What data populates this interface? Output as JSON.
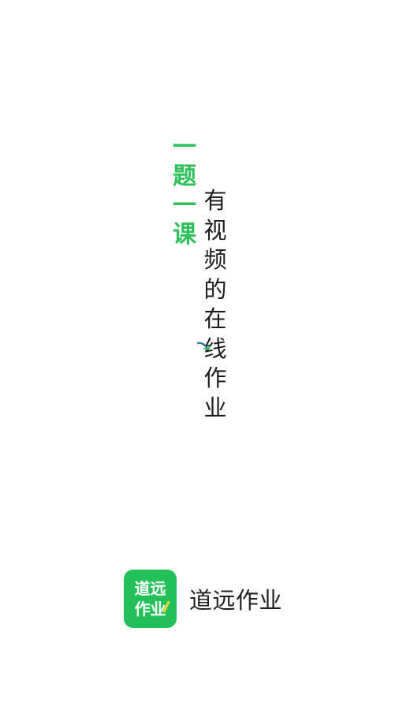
{
  "slogan": {
    "primary": [
      "一",
      "题",
      "一",
      "课"
    ],
    "secondary": [
      "有",
      "视",
      "频",
      "的",
      "在",
      "线",
      "作",
      "业"
    ]
  },
  "brand": {
    "icon_line1": "道远",
    "icon_line2": "作业",
    "app_name": "道远作业"
  },
  "colors": {
    "accent_green": "#2ec05a",
    "icon_green": "#23c05a",
    "text_dark": "#1c1c1c",
    "background": "#ffffff",
    "pencil_yellow": "#f5d536"
  }
}
